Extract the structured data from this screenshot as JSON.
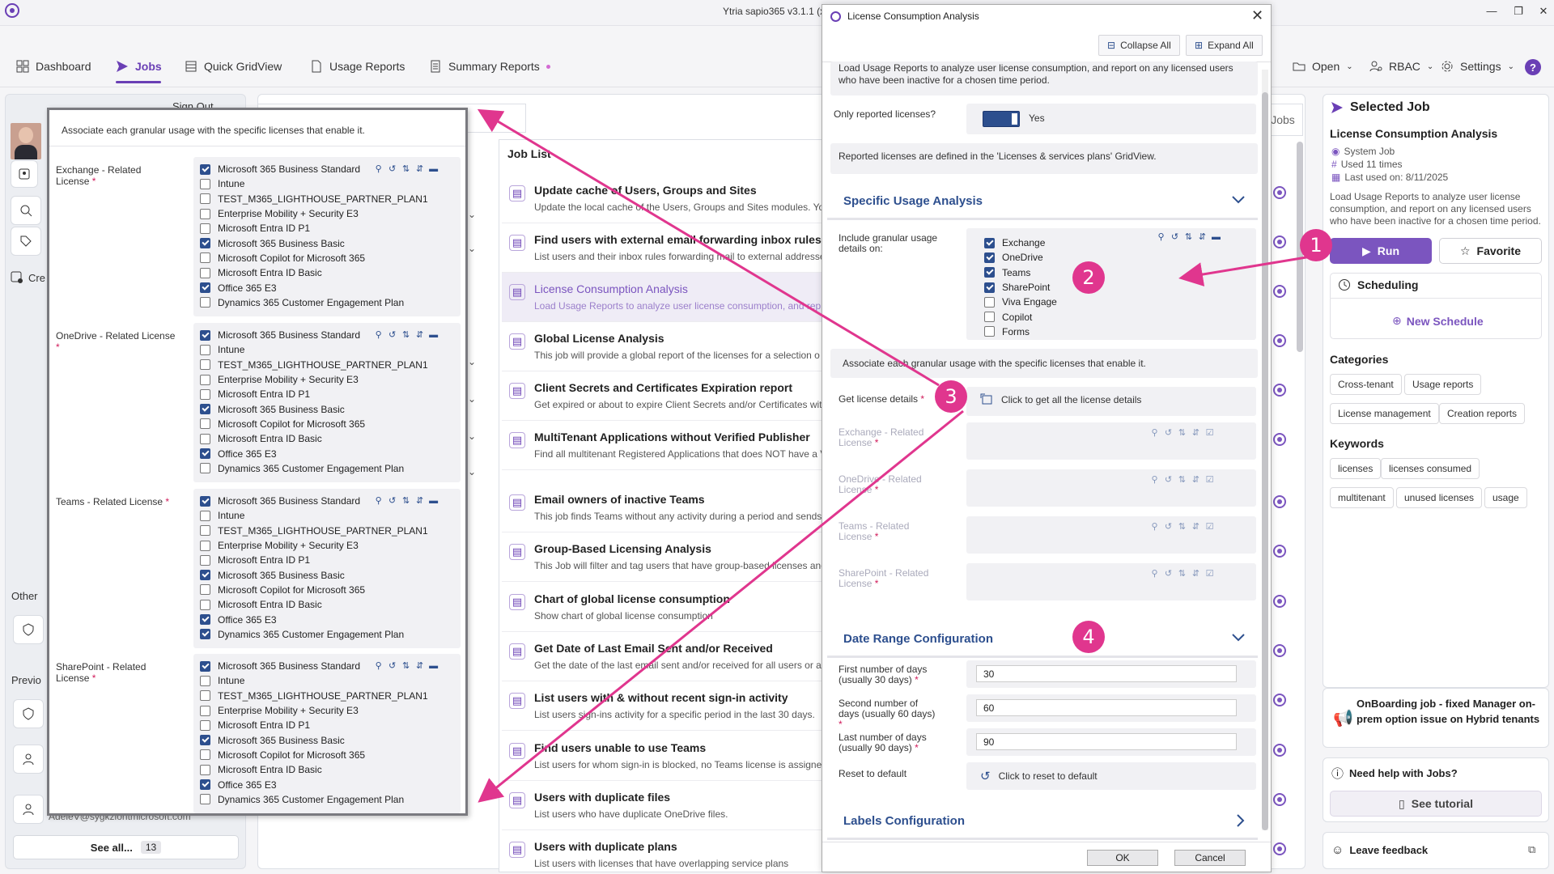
{
  "app": {
    "title": "Ytria sapio365 v3.1.1 (x6"
  },
  "nav": {
    "tabs": [
      {
        "label": "Dashboard"
      },
      {
        "label": "Jobs"
      },
      {
        "label": "Quick GridView"
      },
      {
        "label": "Usage Reports"
      },
      {
        "label": "Summary Reports"
      }
    ],
    "right": {
      "open": "Open",
      "rbac": "RBAC",
      "settings": "Settings"
    }
  },
  "left": {
    "sign_out": "Sign Out",
    "cre": "Cre",
    "other": "Other",
    "previous": "Previo",
    "email": "AdeleV@sygkziontmicrosoft.com",
    "see_all": "See all...",
    "see_all_count": "13"
  },
  "joblist": {
    "header": "Job List",
    "jobs_tab": "Jobs",
    "items": [
      {
        "title": "Update cache of Users, Groups and Sites",
        "desc": "Update the local cache of the Users, Groups and Sites modules. You"
      },
      {
        "title": "Find users with external email forwarding inbox rules",
        "desc": "List users and their inbox rules forwarding mail to external addresse"
      },
      {
        "title": "License Consumption Analysis",
        "desc": "Load Usage Reports to analyze user license consumption, and rep"
      },
      {
        "title": "Global License Analysis",
        "desc": "This job will provide a global report of the licenses for a selection o"
      },
      {
        "title": "Client Secrets and Certificates Expiration report",
        "desc": "Get expired or about to expire Client Secrets and/or Certificates wit"
      },
      {
        "title": "MultiTenant Applications without Verified Publisher",
        "desc": "Find all multitenant Registered Applications that does NOT have a V applications."
      },
      {
        "title": "Email owners of inactive Teams",
        "desc": "This job finds Teams without any activity during a period and sends"
      },
      {
        "title": "Group-Based Licensing Analysis",
        "desc": "This Job will filter and tag users that have group-based licenses and"
      },
      {
        "title": "Chart of global license consumption",
        "desc": "Show chart of global license consumption"
      },
      {
        "title": "Get Date of Last Email Sent and/or Received",
        "desc": "Get the date of the last email sent and/or received for all users or a"
      },
      {
        "title": "List users with & without recent sign-in activity",
        "desc": "List users sign-ins activity for a specific period in the last 30 days."
      },
      {
        "title": "Find users unable to use Teams",
        "desc": "List users for whom sign-in is blocked, no Teams license is assigned"
      },
      {
        "title": "Users with duplicate files",
        "desc": "List users who have duplicate OneDrive files."
      },
      {
        "title": "Users with duplicate plans",
        "desc": "List users with licenses that have overlapping service plans"
      }
    ]
  },
  "selected_job": {
    "header": "Selected Job",
    "name": "License Consumption Analysis",
    "type": "System Job",
    "used": "Used 11 times",
    "last_used": "Last used on: 8/11/2025",
    "description": "Load Usage Reports to analyze user license consumption, and report on any licensed users who have been inactive for a chosen time period.",
    "run": "Run",
    "favorite": "Favorite",
    "scheduling": "Scheduling",
    "new_schedule": "New Schedule",
    "categories_label": "Categories",
    "categories": [
      "Cross-tenant",
      "Usage reports",
      "License management",
      "Creation reports"
    ],
    "keywords_label": "Keywords",
    "keywords": [
      "licenses",
      "licenses consumed",
      "multitenant",
      "unused licenses",
      "usage"
    ],
    "onboarding": "OnBoarding job - fixed Manager on-prem option issue on Hybrid tenants",
    "help": "Need help with Jobs?",
    "tutorial": "See tutorial",
    "feedback": "Leave feedback"
  },
  "overlay": {
    "header": "Associate each granular usage with the specific licenses that enable it.",
    "groups": [
      {
        "label": "Exchange - Related License"
      },
      {
        "label": "OneDrive - Related License"
      },
      {
        "label": "Teams - Related License"
      },
      {
        "label": "SharePoint - Related License"
      }
    ],
    "licenses": [
      "Microsoft 365 Business Standard",
      "Intune",
      "TEST_M365_LIGHTHOUSE_PARTNER_PLAN1",
      "Enterprise Mobility + Security E3",
      "Microsoft Entra ID P1",
      "Microsoft 365 Business Basic",
      "Microsoft Copilot for Microsoft 365",
      "Microsoft Entra ID Basic",
      "Office 365 E3",
      "Dynamics 365 Customer Engagement Plan"
    ],
    "checked": [
      [
        true,
        false,
        false,
        false,
        false,
        true,
        false,
        false,
        true,
        false
      ],
      [
        true,
        false,
        false,
        false,
        false,
        true,
        false,
        false,
        true,
        false
      ],
      [
        true,
        false,
        false,
        false,
        false,
        true,
        false,
        false,
        true,
        true
      ],
      [
        true,
        false,
        false,
        false,
        false,
        true,
        false,
        false,
        true,
        false
      ]
    ],
    "required_mark": "*"
  },
  "dialog": {
    "title": "License Consumption Analysis",
    "collapse_all": "Collapse All",
    "expand_all": "Expand All",
    "intro": "Load Usage Reports to analyze user license consumption, and report on any licensed users who have been inactive for a chosen time period.",
    "only_reported_label": "Only reported licenses?",
    "only_reported_value": "Yes",
    "reported_note": "Reported licenses are defined in the 'Licenses & services plans' GridView.",
    "specific_usage": "Specific Usage Analysis",
    "include_label": "Include granular usage details on:",
    "usages": [
      {
        "label": "Exchange",
        "checked": true
      },
      {
        "label": "OneDrive",
        "checked": true
      },
      {
        "label": "Teams",
        "checked": true
      },
      {
        "label": "SharePoint",
        "checked": true
      },
      {
        "label": "Viva Engage",
        "checked": false
      },
      {
        "label": "Copilot",
        "checked": false
      },
      {
        "label": "Forms",
        "checked": false
      }
    ],
    "associate": "Associate each granular usage with the specific licenses that enable it.",
    "get_license_label": "Get license details",
    "get_license_action": "Click to get all the license details",
    "related": [
      "Exchange - Related License",
      "OneDrive - Related License",
      "Teams - Related License",
      "SharePoint - Related License"
    ],
    "date_range": "Date Range Configuration",
    "first_label": "First number of days (usually 30 days)",
    "first_value": "30",
    "second_label": "Second number of days (usually 60 days)",
    "second_value": "60",
    "last_label": "Last number of days (usually 90 days)",
    "last_value": "90",
    "reset_label": "Reset to default",
    "reset_action": "Click to reset to default",
    "labels_config": "Labels Configuration",
    "ok": "OK",
    "cancel": "Cancel"
  },
  "badges": [
    "1",
    "2",
    "3",
    "4"
  ],
  "colors": {
    "accent": "#6a3fb5",
    "dialog_blue": "#2d4f8e",
    "annotation": "#e0368e"
  }
}
